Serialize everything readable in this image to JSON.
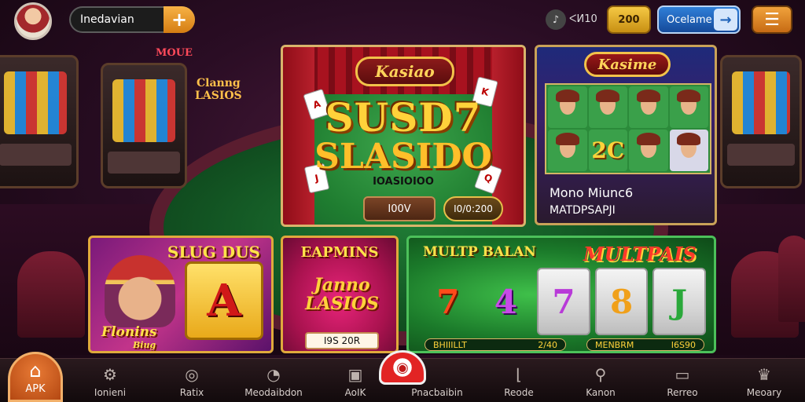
{
  "header": {
    "username": "Inedavian",
    "plus_label": "+",
    "sound_icon": "sound-icon",
    "sound_label": "ᐸИ10",
    "coins": "200",
    "login_label": "Ocelame",
    "login_arrow": "→",
    "menu_label": "☰"
  },
  "background": {
    "neon_mode": "MOUE",
    "neon_sign": [
      "Clanng",
      "LASIOS"
    ]
  },
  "featured": {
    "badge": "Kasiao",
    "title_line1": "SUSD7",
    "title_line2": "SLASIDO",
    "subtitle": "IOASIOIOO",
    "btn_play": "I00V",
    "btn_amount": "I0/0:200"
  },
  "characters": {
    "badge": "Kasime",
    "number_tile": "2C",
    "line1": "Mono Miunc6",
    "line2": "MATDPSAPJI"
  },
  "slug_card": {
    "title": "SLUG DUS",
    "big_letter": "A",
    "sub_line1": "Flonins",
    "sub_line2": "Biug"
  },
  "eap_card": {
    "title": "EAPMINS",
    "logo_line1": "Janno",
    "logo_line2": "LASIOS",
    "button": "I9S 20R"
  },
  "multi_card": {
    "title_left": "MULTP BALAN",
    "title_right": "MULTPAIS",
    "reels": [
      "7",
      "4",
      "7",
      "8",
      "J"
    ],
    "bar1_left": "BHIIILLT",
    "bar1_right": "2/40",
    "bar2_left": "MENBRM",
    "bar2_right": "I6S90"
  },
  "bottom_nav": {
    "home": "APK",
    "items": [
      "Ionieni",
      "Ratix",
      "Meodaibdon",
      "AoIK",
      "Pnacbaibin",
      "Reode",
      "Kanon",
      "Rerreo",
      "Meoary"
    ]
  },
  "colors": {
    "accent_orange": "#e87a35",
    "gold": "#ffd23a",
    "felt_green": "#1f7d30",
    "login_blue": "#2f7fd8"
  }
}
